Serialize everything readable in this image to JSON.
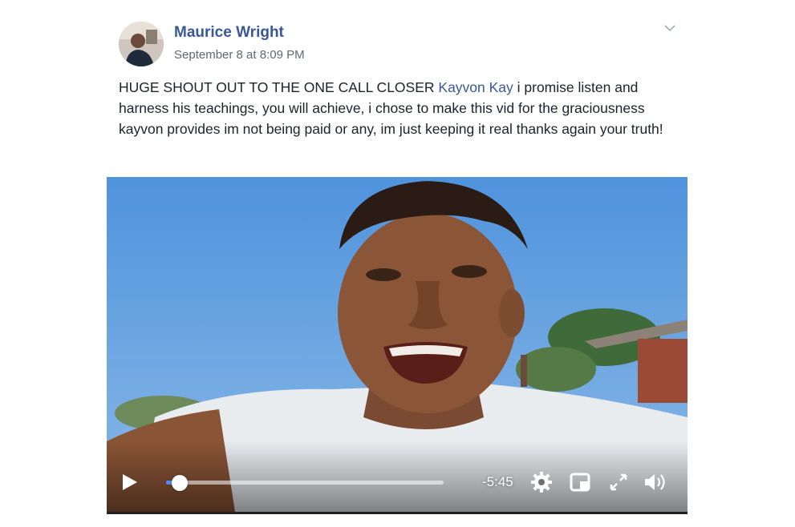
{
  "post": {
    "author": "Maurice Wright",
    "timestamp": "September 8 at 8:09 PM",
    "text_before_mention": "HUGE SHOUT OUT TO THE ONE CALL CLOSER ",
    "mention": "Kayvon Kay",
    "text_after_mention": " i promise listen and harness his teachings, you will achieve, i chose to make this vid for the graciousness kayvon provides im not being paid or any, im just keeping it real thanks again your truth!"
  },
  "icons": {
    "options": "chevron-down-icon",
    "play": "play-icon",
    "settings": "gear-icon",
    "pip": "picture-in-picture-icon",
    "fullscreen": "fullscreen-icon",
    "volume": "volume-icon"
  },
  "video": {
    "progress_fraction": 0.05,
    "time_remaining": "-5:45"
  },
  "colors": {
    "link": "#385898",
    "progress": "#4f8cff",
    "sky": "#5a9ad8"
  }
}
